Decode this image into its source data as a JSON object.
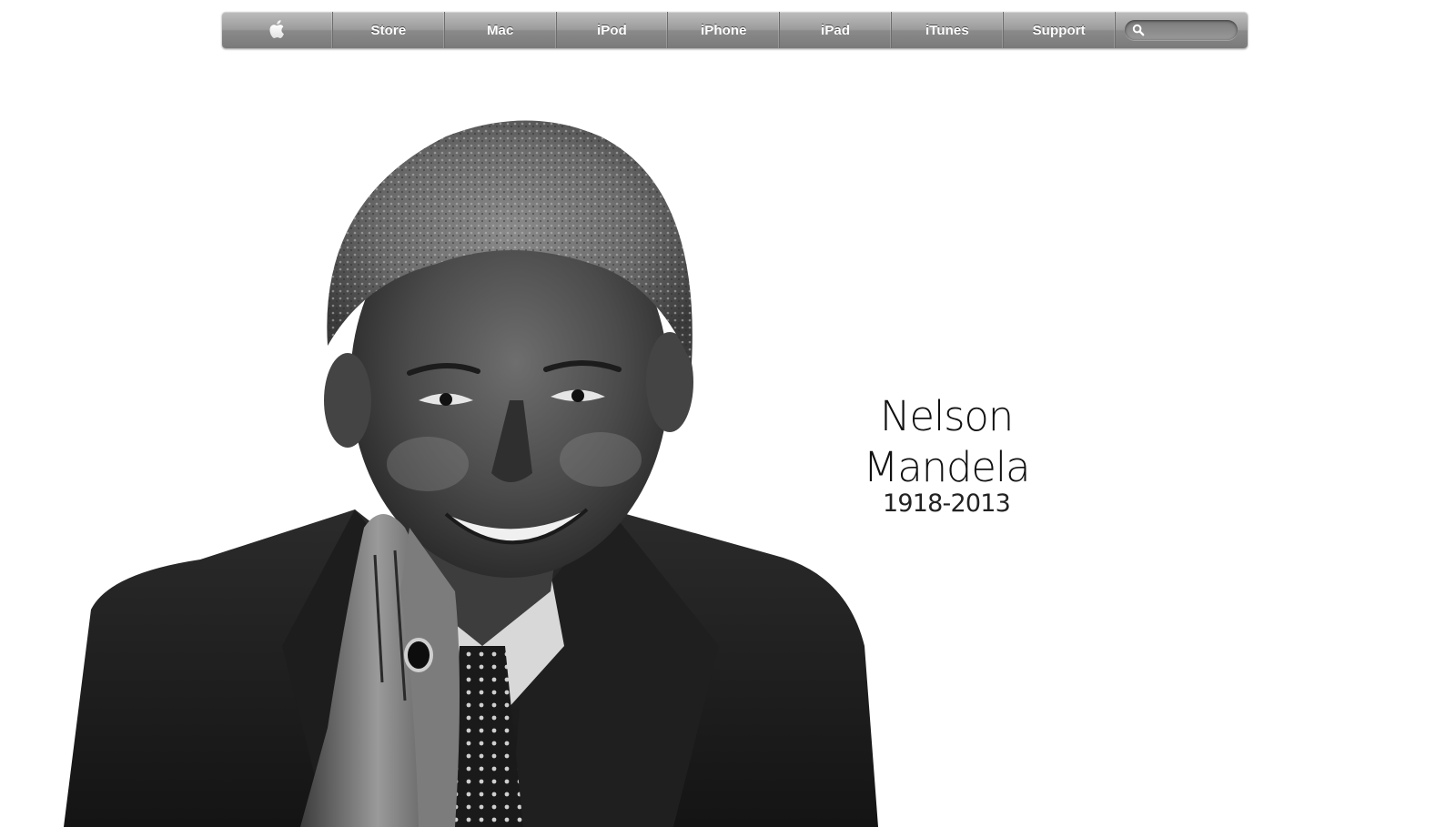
{
  "nav": {
    "apple_icon": "apple-logo-icon",
    "items": [
      {
        "label": "Store"
      },
      {
        "label": "Mac"
      },
      {
        "label": "iPod"
      },
      {
        "label": "iPhone"
      },
      {
        "label": "iPad"
      },
      {
        "label": "iTunes"
      },
      {
        "label": "Support"
      }
    ],
    "search": {
      "value": "",
      "placeholder": "",
      "icon": "search-icon"
    }
  },
  "hero": {
    "name": "Nelson Mandela",
    "dates": "1918-2013",
    "photo": "black-and-white portrait photograph"
  },
  "colors": {
    "nav_top": "#bdbdbd",
    "nav_bottom": "#7a7a7a",
    "nav_text": "#ffffff",
    "background": "#ffffff",
    "caption_text": "#111111"
  }
}
